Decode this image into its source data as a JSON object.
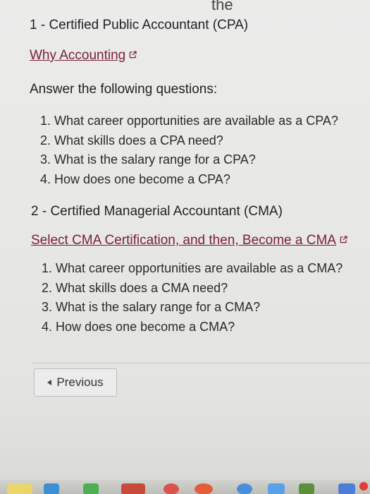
{
  "top_clipped_text": "the",
  "sections": [
    {
      "heading": "1 - Certified Public Accountant (CPA)",
      "link_label": "Why Accounting",
      "prompt": "Answer the following questions:",
      "questions": [
        "1. What career opportunities are available as a CPA?",
        "2. What skills does a CPA need?",
        "3. What is the salary range for a CPA?",
        "4. How does one become a CPA?"
      ]
    },
    {
      "heading": "2 - Certified Managerial Accountant (CMA)",
      "link_label": "Select CMA Certification, and then, Become a CMA",
      "questions": [
        "1. What career opportunities are available as a CMA?",
        "2. What skills does a CMA need?",
        "3. What is the salary range for a CMA?",
        "4. How does one become a CMA?"
      ]
    }
  ],
  "navigation": {
    "previous_label": "Previous"
  },
  "colors": {
    "link": "#7a2036",
    "page_background": "#e8e8e6",
    "text": "#2a2a2a"
  },
  "icons": {
    "external_link": "external-link-icon",
    "previous_caret": "caret-left-icon"
  }
}
